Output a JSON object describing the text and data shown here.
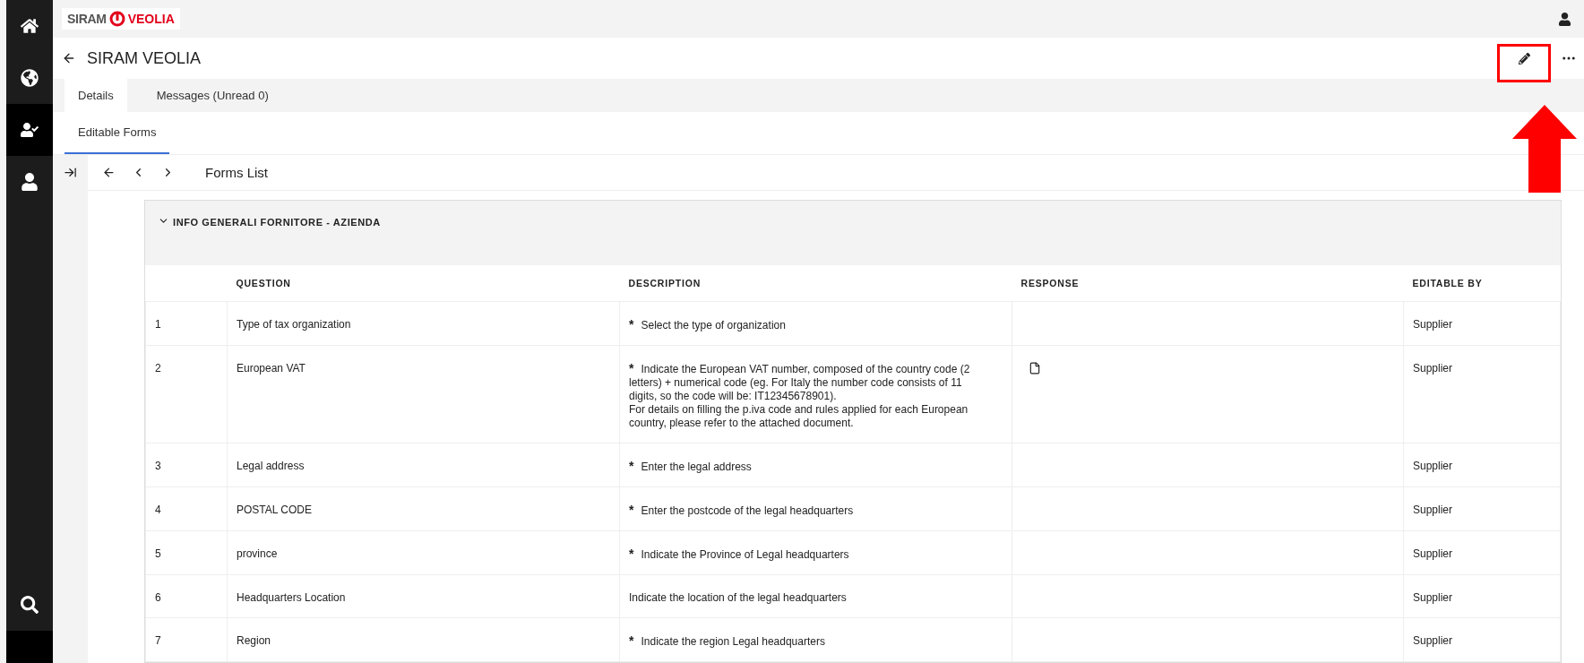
{
  "sidebar": {
    "items": [
      {
        "kind": "home",
        "selected": false
      },
      {
        "kind": "globe-search",
        "selected": false
      },
      {
        "kind": "user-check",
        "selected": true
      },
      {
        "kind": "user",
        "selected": false
      }
    ],
    "bottom_items": [
      {
        "kind": "search",
        "selected": false
      }
    ]
  },
  "header": {
    "logo": {
      "left": "SIRAM",
      "right": "VEOLIA"
    }
  },
  "page": {
    "title": "SIRAM VEOLIA"
  },
  "tabs": [
    {
      "label": "Details",
      "selected": true
    },
    {
      "label": "Messages (Unread 0)",
      "selected": false
    }
  ],
  "subtabs": [
    {
      "label": "Editable Forms",
      "selected": true
    }
  ],
  "toolbar": {
    "title": "Forms List"
  },
  "section": {
    "title": "INFO GENERALI FORNITORE - AZIENDA",
    "expanded": true
  },
  "table": {
    "columns": [
      "QUESTION",
      "DESCRIPTION",
      "RESPONSE",
      "EDITABLE BY"
    ],
    "rows": [
      {
        "number": "1",
        "question": "Type of tax organization",
        "marker": "*",
        "description": "Select the type of organization",
        "editable_by": "Supplier"
      },
      {
        "number": "2",
        "question": "European VAT",
        "marker": "*",
        "description": "Indicate the European VAT number, composed of the country code (2 letters) + numerical code (eg. For Italy the number code consists of 11 digits, so the code will be: IT12345678901).\nFor details on filling the p.iva code and rules applied for each European country, please refer to the attached document.",
        "response": {
          "kind": "document"
        },
        "editable_by": "Supplier"
      },
      {
        "number": "3",
        "question": "Legal address",
        "marker": "*",
        "description": "Enter the legal address",
        "editable_by": "Supplier"
      },
      {
        "number": "4",
        "question": "POSTAL CODE",
        "marker": "*",
        "description": "Enter the postcode of the legal headquarters",
        "editable_by": "Supplier"
      },
      {
        "number": "5",
        "question": "province",
        "marker": "*",
        "description": "Indicate the Province of Legal headquarters",
        "editable_by": "Supplier"
      },
      {
        "number": "6",
        "question": "Headquarters Location",
        "description": "Indicate the location of the legal headquarters",
        "editable_by": "Supplier"
      },
      {
        "number": "7",
        "question": "Region",
        "marker": "*",
        "description": "Indicate the region Legal headquarters",
        "editable_by": "Supplier"
      }
    ]
  }
}
